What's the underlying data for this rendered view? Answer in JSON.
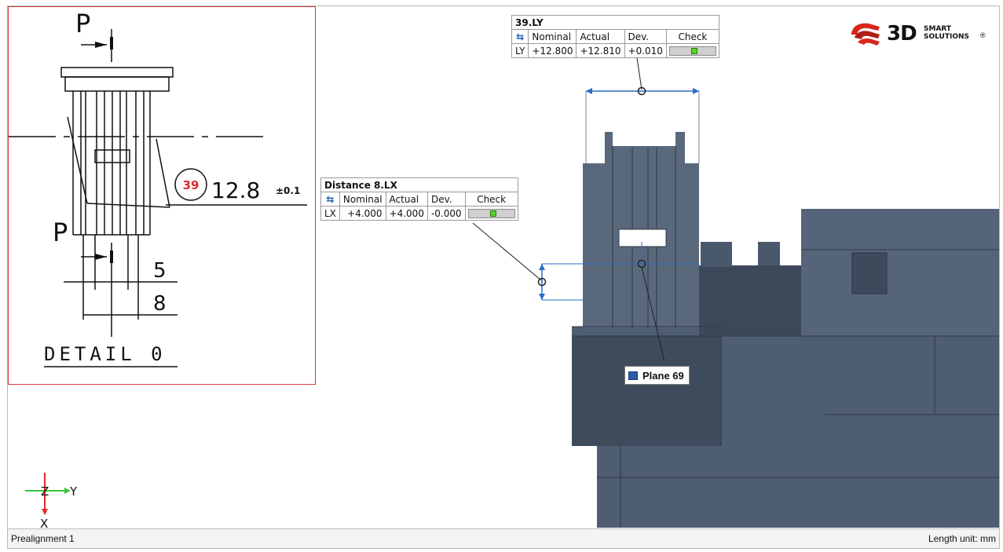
{
  "drawing": {
    "section_top": "P",
    "section_bottom": "P",
    "balloon": "39",
    "dimension_main": "12.8",
    "tolerance": "±0.1",
    "dim_5": "5",
    "dim_8": "8",
    "detail_label": "DETAIL 0"
  },
  "table_ly": {
    "title": "39.LY",
    "headers": [
      "Nominal",
      "Actual",
      "Dev.",
      "Check"
    ],
    "row_label": "LY",
    "nominal": "+12.800",
    "actual": "+12.810",
    "dev": "+0.010"
  },
  "table_lx": {
    "title": "Distance 8.LX",
    "headers": [
      "Nominal",
      "Actual",
      "Dev.",
      "Check"
    ],
    "row_label": "LX",
    "nominal": "+4.000",
    "actual": "+4.000",
    "dev": "-0.000"
  },
  "plane_label": "Plane 69",
  "logo": {
    "big": "3D",
    "line1": "SMART",
    "line2": "SOLUTIONS",
    "reg": "®"
  },
  "axes": {
    "z": "Z",
    "y": "Y",
    "x": "X"
  },
  "status": {
    "left": "Prealignment 1",
    "right": "Length unit: mm"
  },
  "colors": {
    "model": "#4e5d72",
    "accent": "#2b6cc4",
    "check_ok": "#54d423",
    "frame": "#d23a3a"
  }
}
